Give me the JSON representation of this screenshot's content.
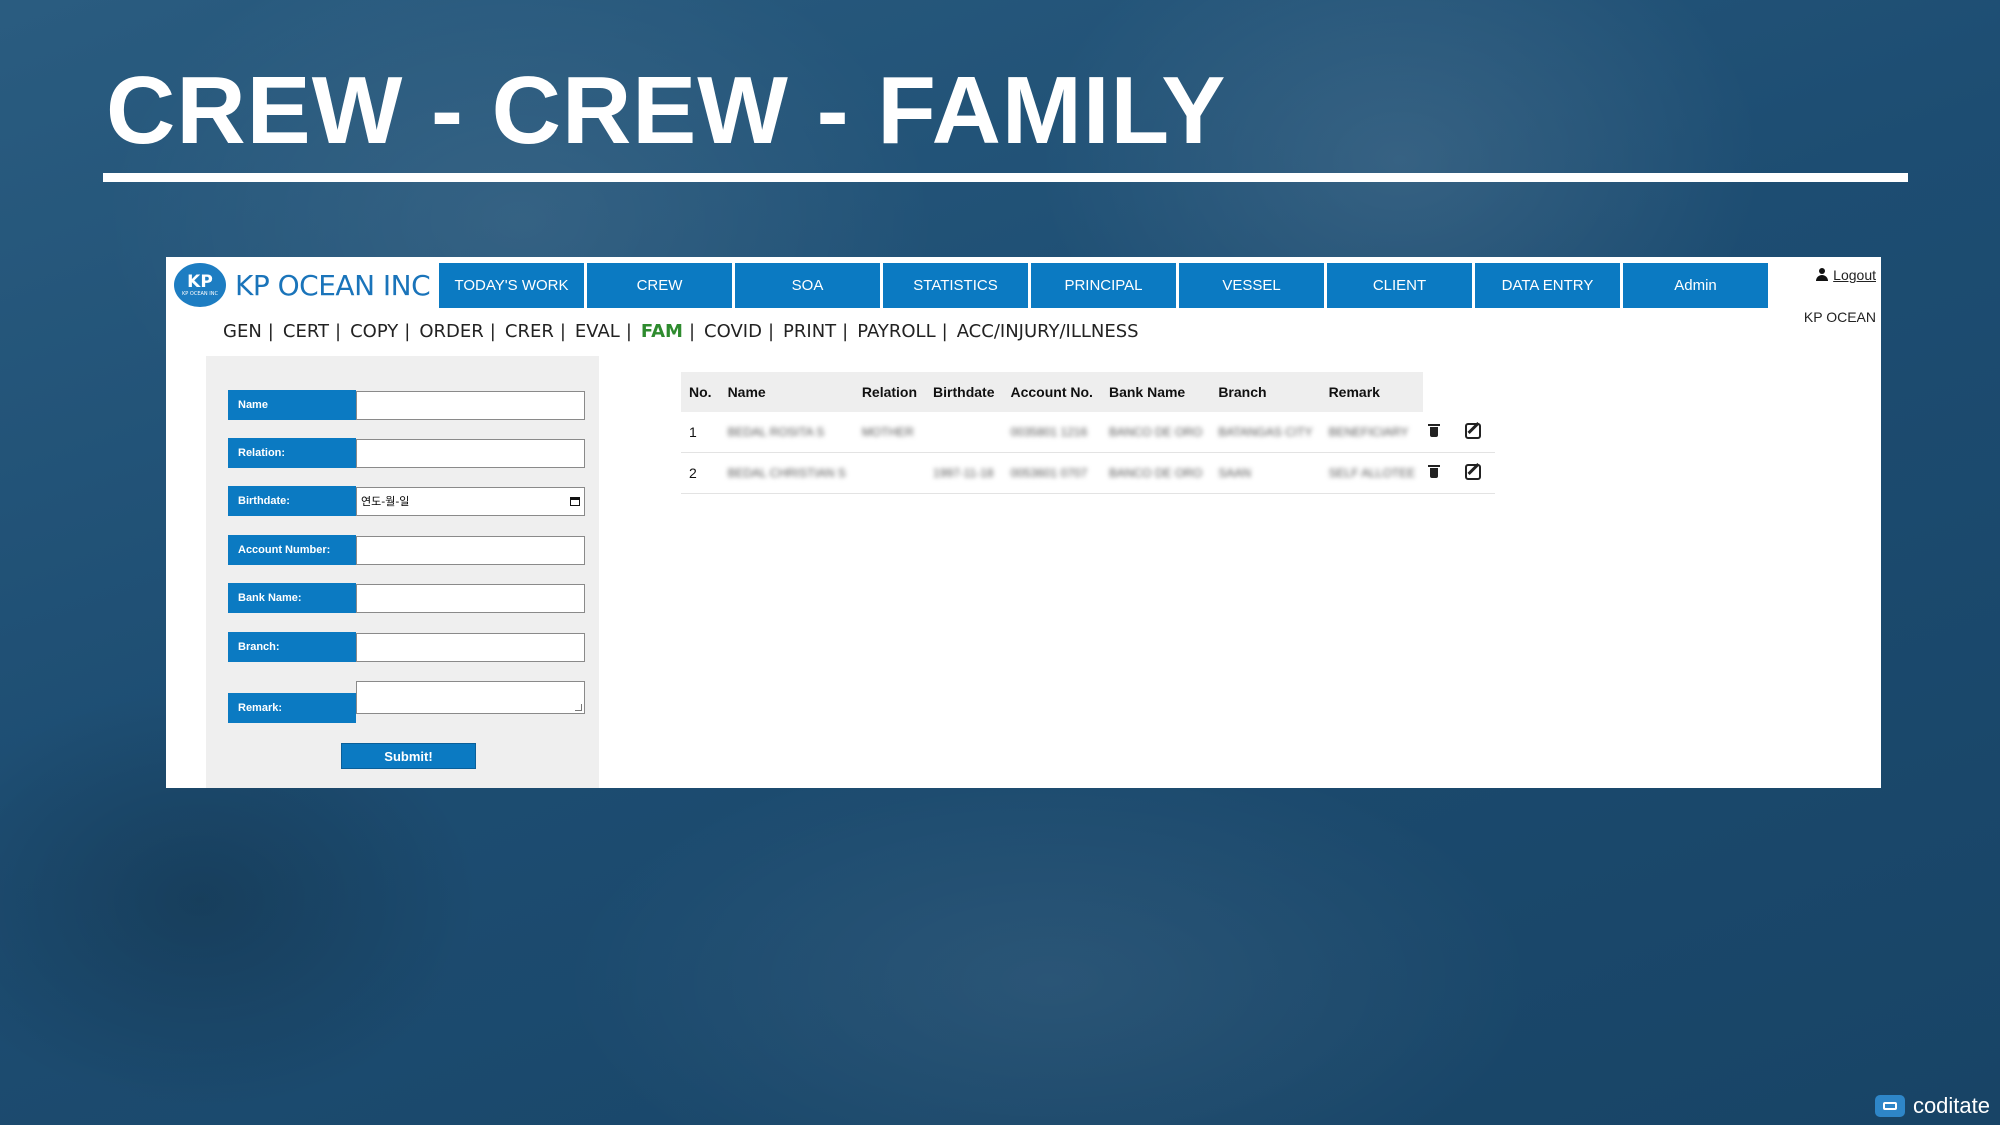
{
  "slide": {
    "title": "CREW - CREW - FAMILY"
  },
  "brand": {
    "badge": "KP",
    "badge_small": "KP OCEAN INC",
    "name": "KP OCEAN INC"
  },
  "nav": [
    "TODAY'S WORK",
    "CREW",
    "SOA",
    "STATISTICS",
    "PRINCIPAL",
    "VESSEL",
    "CLIENT",
    "DATA ENTRY",
    "Admin"
  ],
  "user": {
    "logout_label": "Logout",
    "company": "KP OCEAN"
  },
  "subnav": [
    "GEN",
    "CERT",
    "COPY",
    "ORDER",
    "CRER",
    "EVAL",
    "FAM",
    "COVID",
    "PRINT",
    "PAYROLL",
    "ACC/INJURY/ILLNESS"
  ],
  "subnav_active": "FAM",
  "form": {
    "name_label": "Name",
    "relation_label": "Relation:",
    "birthdate_label": "Birthdate:",
    "birthdate_placeholder": "연도-월-일",
    "account_label": "Account Number:",
    "bank_label": "Bank Name:",
    "branch_label": "Branch:",
    "remark_label": "Remark:",
    "submit_label": "Submit!"
  },
  "table": {
    "columns": [
      "No.",
      "Name",
      "Relation",
      "Birthdate",
      "Account No.",
      "Bank Name",
      "Branch",
      "Remark"
    ],
    "rows": [
      [
        "1",
        "BEDAL ROSITA S",
        "MOTHER",
        "",
        "0035801 1216",
        "BANCO DE ORO",
        "BATANGAS CITY",
        "BENEFICIARY"
      ],
      [
        "2",
        "BEDAL CHRISTIAN S",
        "",
        "1997-11-18",
        "0053601 0707",
        "BANCO DE ORO",
        "SAAN",
        "SELF ALLOTEE"
      ]
    ]
  },
  "watermark": {
    "text": "coditate"
  },
  "colors": {
    "nav_blue": "#0b7ac2",
    "active_tab": "#2e8b2e",
    "background": "#1d4d72"
  }
}
